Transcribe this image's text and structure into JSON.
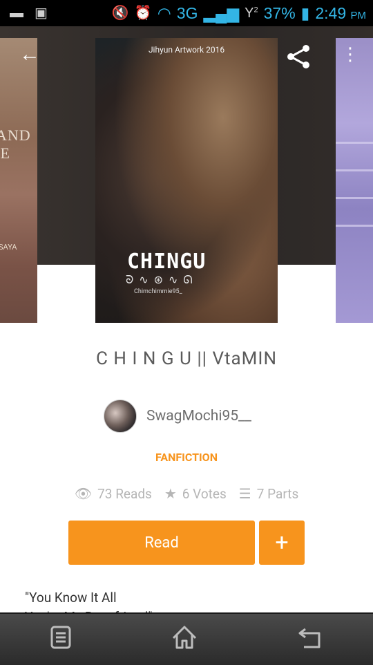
{
  "status_bar": {
    "network": "3G",
    "signal_badge": "2",
    "battery": "37%",
    "time": "2:49",
    "ampm": "PM"
  },
  "cover": {
    "artist": "Jihyun Artwork 2016",
    "title": "CHINGU",
    "author_small": "Chimchimmie95_",
    "left_cover_text": "AND\nE",
    "left_cover_sub": "SAYA"
  },
  "story": {
    "title": "C H I N G U || VtaMIN",
    "author": "SwagMochi95__",
    "category": "FANFICTION",
    "reads": "73 Reads",
    "votes": "6 Votes",
    "parts": "7 Parts",
    "read_label": "Read",
    "add_label": "+",
    "description_line1": "\"You Know It All",
    "description_line2": "You're My Best friend\""
  },
  "icons": {
    "back": "back-arrow-icon",
    "share": "share-icon",
    "overflow": "overflow-menu-icon",
    "reads": "eye-icon",
    "votes": "star-icon",
    "parts": "list-icon",
    "nav_recents": "recent-apps-icon",
    "nav_home": "home-icon",
    "nav_back": "back-icon"
  },
  "colors": {
    "accent": "#f7941d",
    "status_blue": "#33b5e5"
  }
}
